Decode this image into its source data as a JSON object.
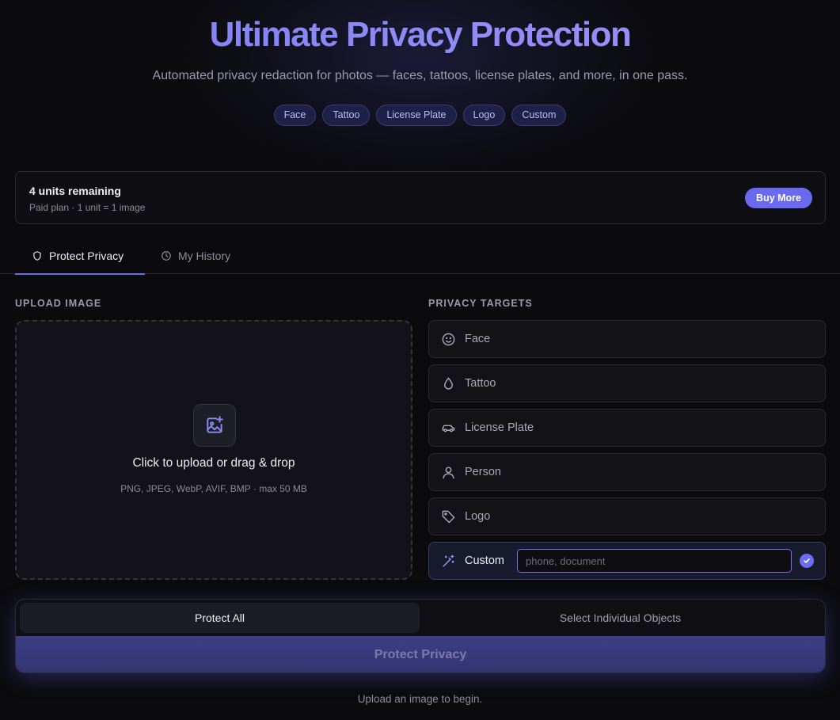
{
  "hero": {
    "title": "Ultimate Privacy Protection",
    "subtitle": "Automated privacy redaction for photos — faces, tattoos, license plates, and more, in one pass.",
    "chips": [
      "Face",
      "Tattoo",
      "License Plate",
      "Logo",
      "Custom"
    ]
  },
  "units": {
    "title": "4 units remaining",
    "subtitle": "Paid plan · 1 unit = 1 image",
    "buy_label": "Buy More"
  },
  "tabs": [
    {
      "label": "Protect Privacy",
      "icon": "shield-icon",
      "active": true
    },
    {
      "label": "My History",
      "icon": "clock-icon",
      "active": false
    }
  ],
  "upload": {
    "section_label": "UPLOAD IMAGE",
    "title": "Click to upload or drag & drop",
    "formats": "PNG, JPEG, WebP, AVIF, BMP · max 50 MB",
    "icon": "image-plus-icon"
  },
  "targets": {
    "section_label": "PRIVACY TARGETS",
    "items": [
      {
        "label": "Face",
        "icon": "smile-icon"
      },
      {
        "label": "Tattoo",
        "icon": "droplet-icon"
      },
      {
        "label": "License Plate",
        "icon": "car-icon"
      },
      {
        "label": "Person",
        "icon": "person-icon"
      },
      {
        "label": "Logo",
        "icon": "tag-icon"
      },
      {
        "label": "Custom",
        "icon": "magic-wand-icon",
        "selected": true,
        "input_placeholder": "phone, document",
        "input_value": ""
      }
    ]
  },
  "mode": {
    "options": [
      "Protect All",
      "Select Individual Objects"
    ],
    "selected": "Protect All"
  },
  "protect_button": "Protect Privacy",
  "status": "Upload an image to begin.",
  "colors": {
    "accent": "#6d6df2",
    "background": "#0b0b0e",
    "chip_bg": "#1f2048"
  }
}
